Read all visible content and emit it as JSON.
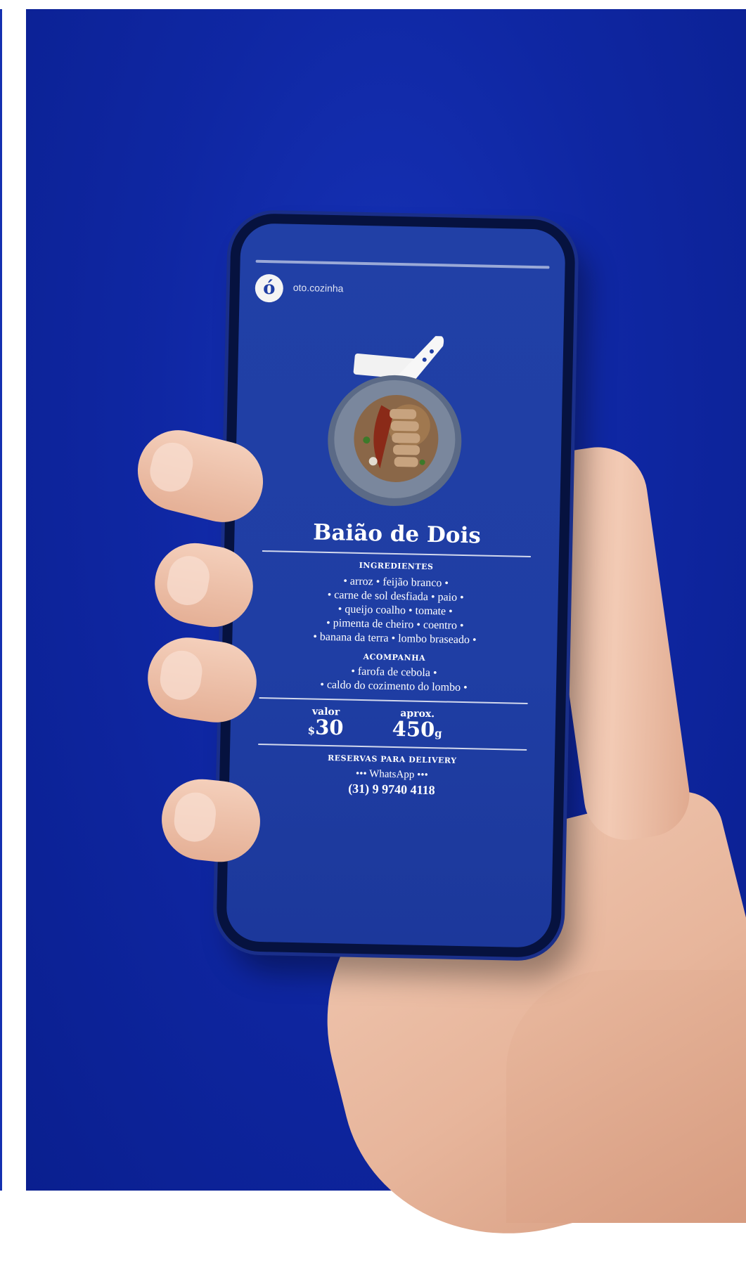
{
  "story": {
    "username": "oto.cozinha",
    "avatar_letter": "ó"
  },
  "dish": {
    "title": "Baião de Dois"
  },
  "ingredients": {
    "heading": "INGREDIENTES",
    "lines": [
      "• arroz • feijão branco •",
      "• carne de sol desfiada • paio •",
      "• queijo coalho • tomate •",
      "• pimenta de cheiro • coentro •",
      "• banana da terra • lombo braseado •"
    ]
  },
  "accompaniment": {
    "heading": "ACOMPANHA",
    "lines": [
      "• farofa de cebola •",
      "• caldo do cozimento do lombo •"
    ]
  },
  "pricing": {
    "value_label": "valor",
    "currency_symbol": "$",
    "value": "30",
    "weight_label": "aprox.",
    "weight": "450",
    "weight_unit": "g"
  },
  "delivery": {
    "heading": "RESERVAS PARA DELIVERY",
    "channel": "••• WhatsApp •••",
    "phone": "(31) 9 9740 4118"
  },
  "colors": {
    "background": "#0f27a3",
    "screen": "#1f3ea4",
    "text": "#ffffff"
  },
  "icons": [
    "knife-icon",
    "pan-icon",
    "avatar-icon"
  ]
}
